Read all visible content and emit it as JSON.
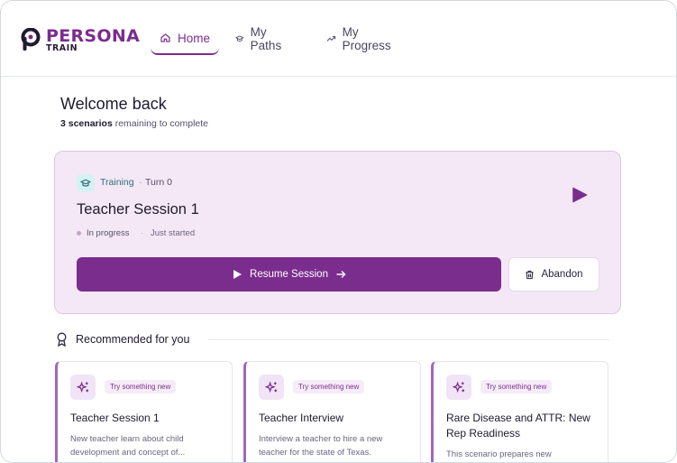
{
  "app": {
    "brand_name": "PERSONA",
    "brand_sub": "TRAIN"
  },
  "nav": {
    "items": [
      {
        "label": "Home",
        "icon": "home-icon",
        "active": true
      },
      {
        "label": "My Paths",
        "icon": "graduation-cap-icon",
        "active": false
      },
      {
        "label": "My Progress",
        "icon": "trend-up-icon",
        "active": false
      }
    ]
  },
  "welcome": {
    "title": "Welcome back",
    "count": "3 scenarios",
    "suffix": "remaining to complete"
  },
  "session": {
    "type_label": "Training",
    "separator": "·",
    "turn_label": "Turn 0",
    "title": "Teacher Session 1",
    "status": "In progress",
    "status_sep": "·",
    "time": "Just started",
    "resume_label": "Resume Session",
    "abandon_label": "Abandon",
    "colors": {
      "accent": "#7b2d8e",
      "card_bg": "#f4e8f6"
    }
  },
  "recommended": {
    "title": "Recommended for you",
    "cards": [
      {
        "tag": "Try something new",
        "title": "Teacher Session 1",
        "description": "New teacher learn about child development and concept of..."
      },
      {
        "tag": "Try something new",
        "title": "Teacher Interview",
        "description": "Interview a teacher to hire a new teacher for the state of Texas."
      },
      {
        "tag": "Try something new",
        "title": "Rare Disease and ATTR: New Rep Readiness",
        "description": "This scenario prepares new"
      }
    ]
  }
}
